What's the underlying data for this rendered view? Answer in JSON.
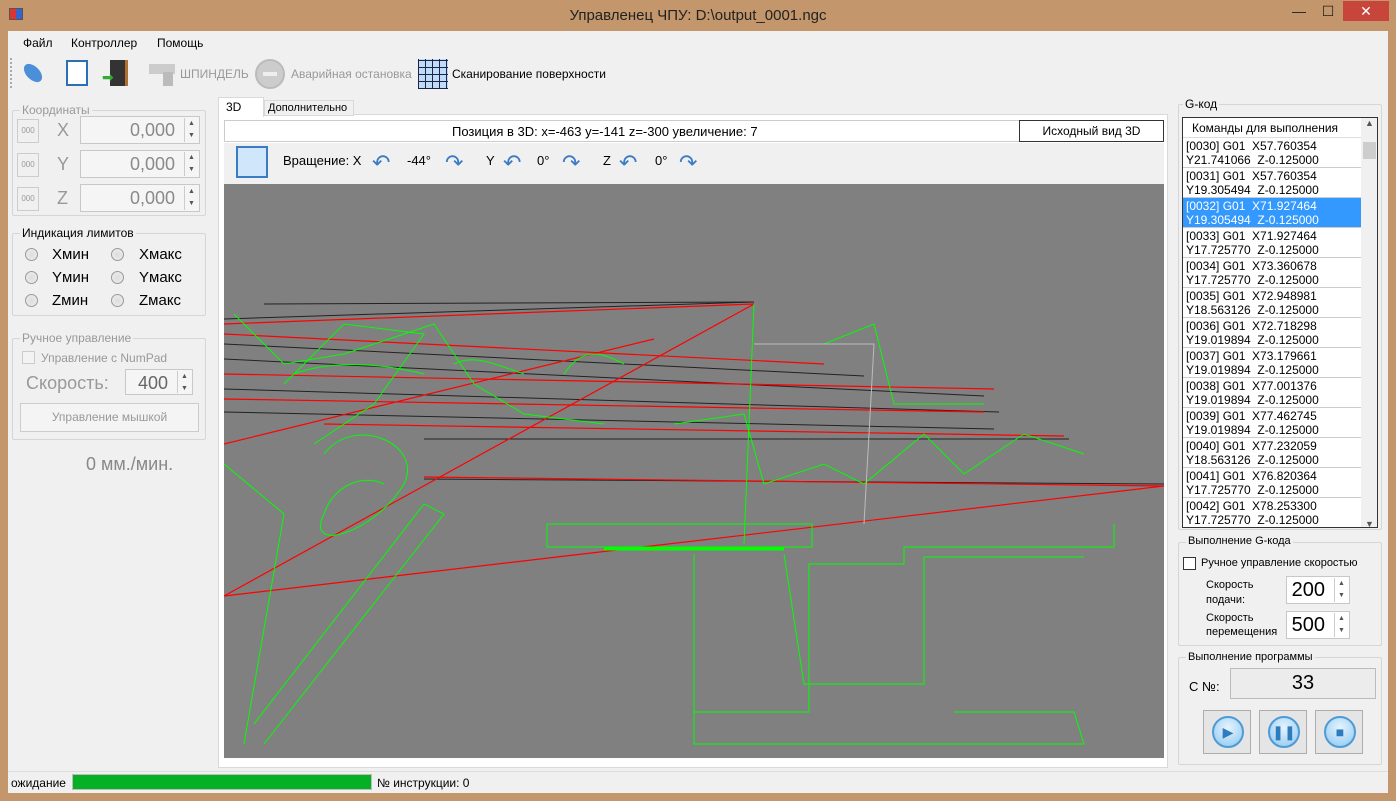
{
  "window": {
    "title": "Управленец ЧПУ: D:\\output_0001.ngc",
    "minimize": "—",
    "maximize": "☐",
    "close": "✕"
  },
  "menu": [
    "Файл",
    "Контроллер",
    "Помощь"
  ],
  "toolbar": {
    "spindle": "ШПИНДЕЛЬ",
    "emergency": "Аварийная остановка",
    "scan": "Сканирование поверхности"
  },
  "coords": {
    "title": "Координаты",
    "axes": [
      {
        "btn": "000",
        "label": "X",
        "value": "0,000"
      },
      {
        "btn": "000",
        "label": "Y",
        "value": "0,000"
      },
      {
        "btn": "000",
        "label": "Z",
        "value": "0,000"
      }
    ]
  },
  "limits": {
    "title": "Индикация лимитов",
    "items": [
      "Xмин",
      "Xмакс",
      "Yмин",
      "Yмакс",
      "Zмин",
      "Zмакс"
    ]
  },
  "manual": {
    "title": "Ручное управление",
    "numpad": "Управление с NumPad",
    "speed_label": "Скорость:",
    "speed": "400",
    "mouse": "Управление мышкой"
  },
  "feed_display": "0 мм./мин.",
  "tabs": [
    "3D",
    "Дополнительно"
  ],
  "view3d": {
    "position": "Позиция в 3D: x=-463 y=-141 z=-300 увеличение: 7",
    "reset": "Исходный вид 3D",
    "rotation": "Вращение: X",
    "x_angle": "-44°",
    "y_label": "Y",
    "y_angle": "0°",
    "z_label": "Z",
    "z_angle": "0°"
  },
  "gcode": {
    "title": "G-код",
    "header": "Команды для выполнения",
    "selected_index": 2,
    "rows": [
      "[0030] G01  X57.760354\nY21.741066  Z-0.125000",
      "[0031] G01  X57.760354\nY19.305494  Z-0.125000",
      "[0032] G01  X71.927464\nY19.305494  Z-0.125000",
      "[0033] G01  X71.927464\nY17.725770  Z-0.125000",
      "[0034] G01  X73.360678\nY17.725770  Z-0.125000",
      "[0035] G01  X72.948981\nY18.563126  Z-0.125000",
      "[0036] G01  X72.718298\nY19.019894  Z-0.125000",
      "[0037] G01  X73.179661\nY19.019894  Z-0.125000",
      "[0038] G01  X77.001376\nY19.019894  Z-0.125000",
      "[0039] G01  X77.462745\nY19.019894  Z-0.125000",
      "[0040] G01  X77.232059\nY18.563126  Z-0.125000",
      "[0041] G01  X76.820364\nY17.725770  Z-0.125000",
      "[0042] G01  X78.253300\nY17.725770  Z-0.125000"
    ]
  },
  "execution": {
    "title": "Выполнение G-кода",
    "manual_speed": "Ручное управление скоростью",
    "feed_label": "Скорость подачи:",
    "feed": "200",
    "move_label": "Скорость перемещения",
    "move": "500"
  },
  "program": {
    "title": "Выполнение программы",
    "line_label": "С №:",
    "line": "33"
  },
  "status": {
    "state": "ожидание",
    "progress": 1.0,
    "instruction": "№ инструкции: 0"
  }
}
